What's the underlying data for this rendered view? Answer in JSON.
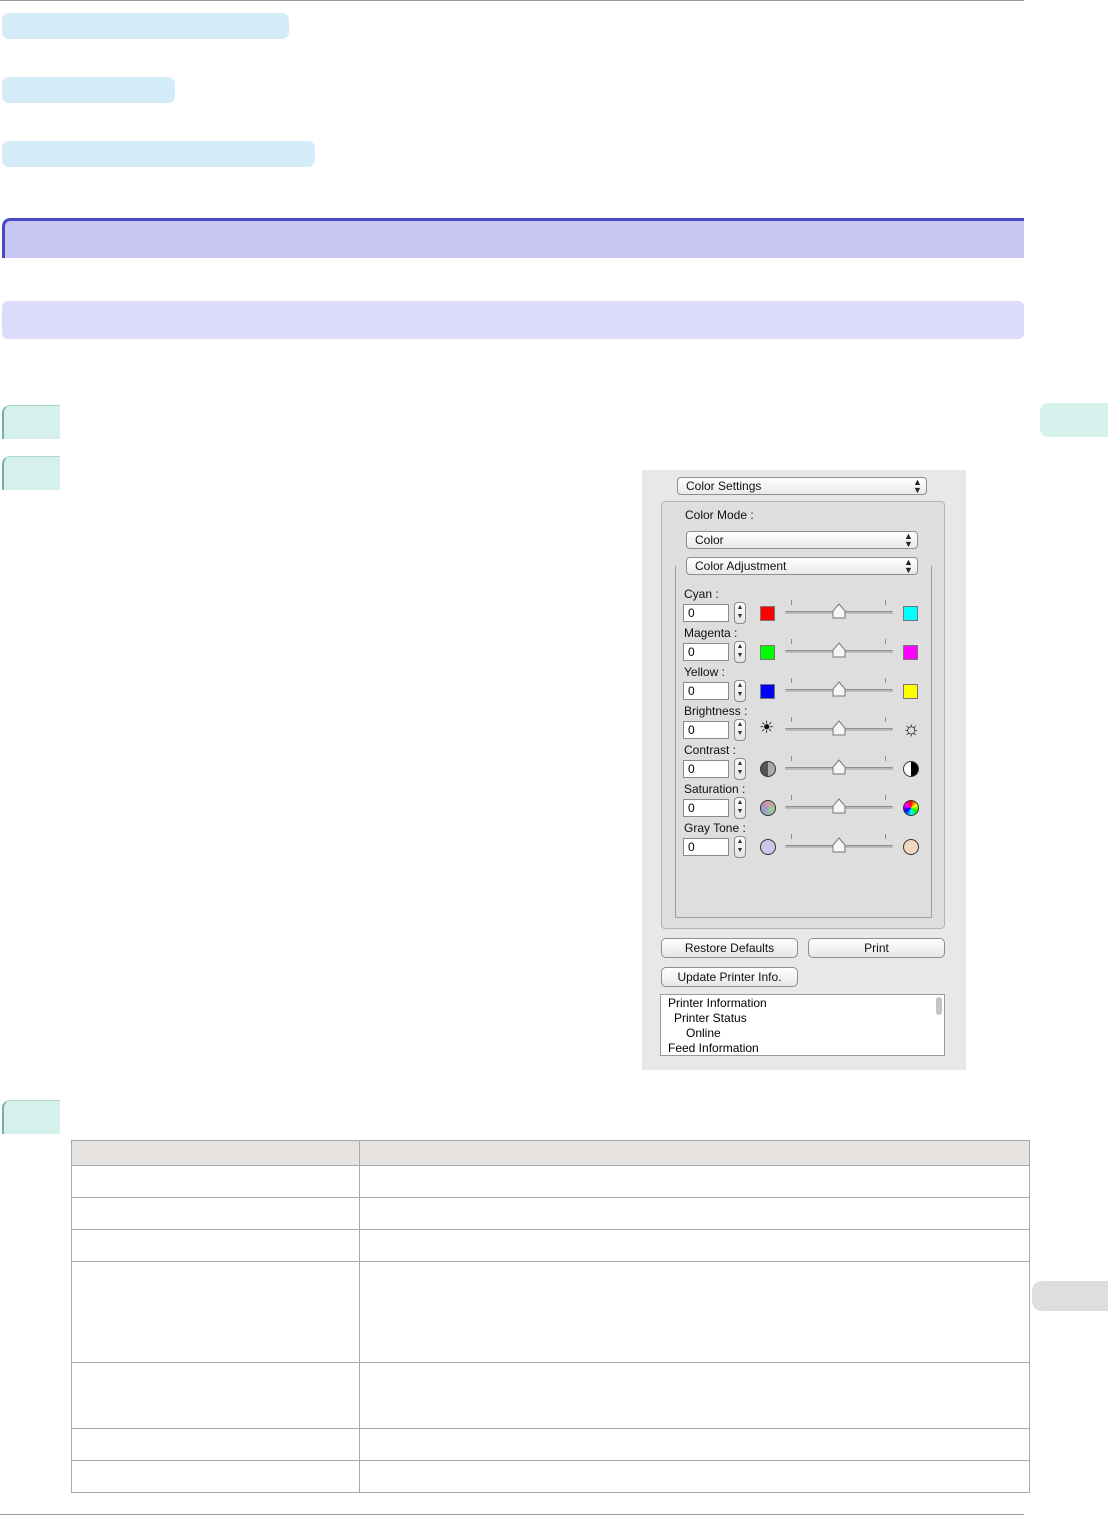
{
  "dialog": {
    "settings_popup": "Color Settings",
    "color_mode_label": "Color Mode :",
    "color_mode_popup": "Color",
    "adjustment_popup": "Color Adjustment",
    "adjustments": [
      {
        "label": "Cyan :",
        "value": "0",
        "left_icon": "red-swatch-icon",
        "right_icon": "cyan-swatch-icon",
        "left_color": "#ff0000",
        "right_color": "#00ffff",
        "level": 0.5
      },
      {
        "label": "Magenta :",
        "value": "0",
        "left_icon": "green-swatch-icon",
        "right_icon": "magenta-swatch-icon",
        "left_color": "#00ff00",
        "right_color": "#ff00ff",
        "level": 0.5
      },
      {
        "label": "Yellow :",
        "value": "0",
        "left_icon": "blue-swatch-icon",
        "right_icon": "yellow-swatch-icon",
        "left_color": "#0000ff",
        "right_color": "#ffff00",
        "level": 0.5
      },
      {
        "label": "Brightness :",
        "value": "0",
        "left_icon": "dark-sun-icon",
        "right_icon": "bright-sun-icon",
        "level": 0.5
      },
      {
        "label": "Contrast :",
        "value": "0",
        "left_icon": "low-contrast-icon",
        "right_icon": "high-contrast-icon",
        "level": 0.5
      },
      {
        "label": "Saturation :",
        "value": "0",
        "left_icon": "low-saturation-icon",
        "right_icon": "high-saturation-icon",
        "level": 0.5
      },
      {
        "label": "Gray Tone :",
        "value": "0",
        "left_icon": "cool-gray-icon",
        "right_icon": "warm-gray-icon",
        "level": 0.5
      }
    ],
    "restore_defaults_label": "Restore Defaults",
    "print_label": "Print",
    "update_info_label": "Update Printer Info.",
    "info_lines": [
      "Printer Information",
      "Printer Status",
      "Online",
      "Feed Information"
    ]
  },
  "colors": {
    "crumb": "#d4ecf8",
    "heading1": "#c9c8f4",
    "heading1_border": "#4a49c4",
    "heading2": "#dcdcfa",
    "step_badge": "#d6f0ec",
    "table_header": "#e6e2df"
  }
}
